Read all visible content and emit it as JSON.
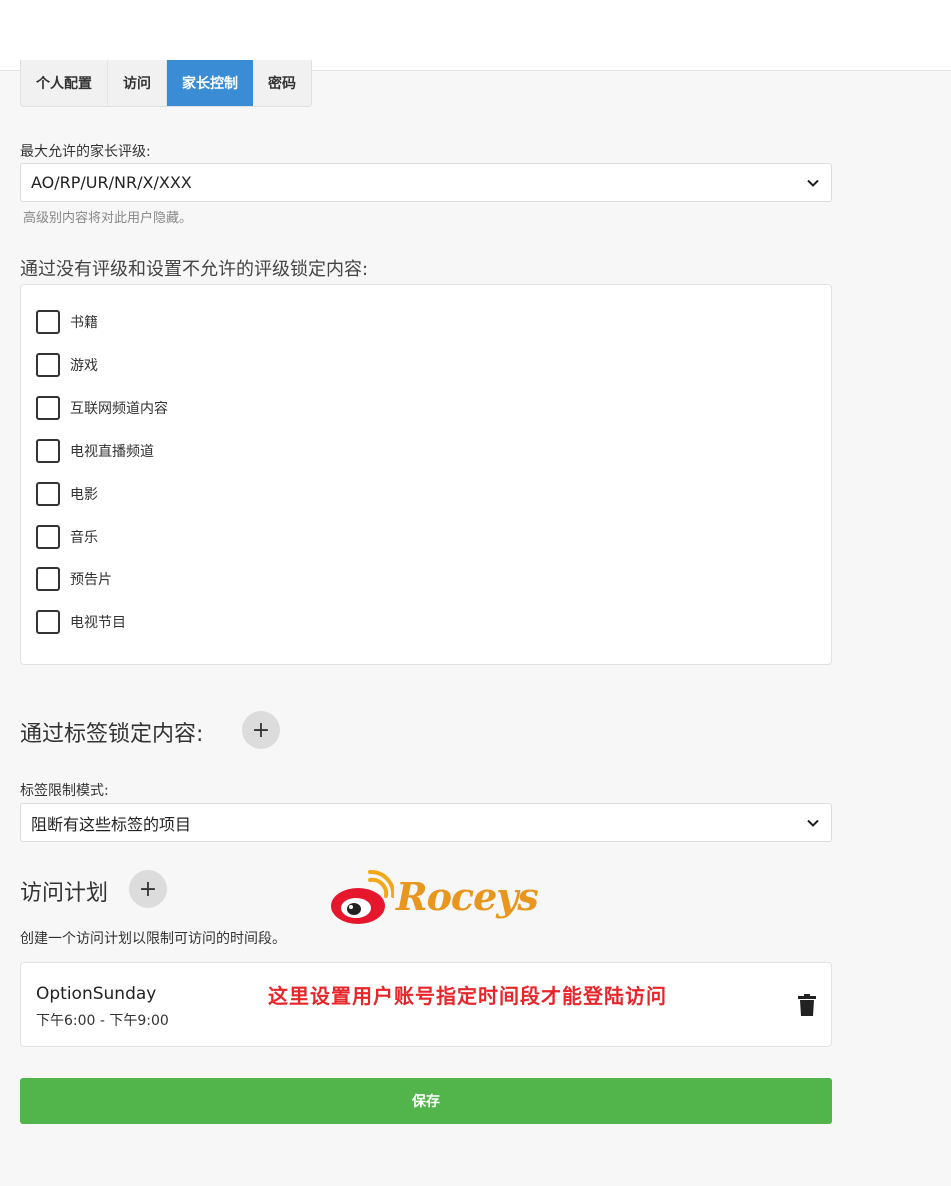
{
  "tabs": [
    {
      "label": "个人配置",
      "active": false
    },
    {
      "label": "访问",
      "active": false
    },
    {
      "label": "家长控制",
      "active": true
    },
    {
      "label": "密码",
      "active": false
    }
  ],
  "max_rating": {
    "label": "最大允许的家长评级:",
    "selected": "AO/RP/UR/NR/X/XXX",
    "hint": "高级别内容将对此用户隐藏。"
  },
  "block_unrated": {
    "heading": "通过没有评级和设置不允许的评级锁定内容:",
    "items": [
      {
        "label": "书籍",
        "checked": false
      },
      {
        "label": "游戏",
        "checked": false
      },
      {
        "label": "互联网频道内容",
        "checked": false
      },
      {
        "label": "电视直播频道",
        "checked": false
      },
      {
        "label": "电影",
        "checked": false
      },
      {
        "label": "音乐",
        "checked": false
      },
      {
        "label": "预告片",
        "checked": false
      },
      {
        "label": "电视节目",
        "checked": false
      }
    ]
  },
  "tags": {
    "heading": "通过标签锁定内容:",
    "add_icon": "+",
    "mode_label": "标签限制模式:",
    "mode_selected": "阻断有这些标签的项目"
  },
  "schedule": {
    "heading": "访问计划",
    "add_icon": "+",
    "description": "创建一个访问计划以限制可访问的时间段。",
    "items": [
      {
        "title": "OptionSunday",
        "time": "下午6:00 - 下午9:00"
      }
    ]
  },
  "overlay": {
    "logo_text": "Roceys",
    "annotation": "这里设置用户账号指定时间段才能登陆访问"
  },
  "save_label": "保存",
  "colors": {
    "accent": "#3a8dd4",
    "save": "#52b54b",
    "annotation": "#e8262a",
    "logo": "#e8961e"
  }
}
